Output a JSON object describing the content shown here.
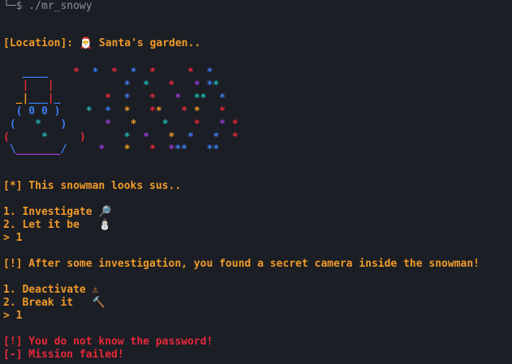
{
  "terminal": {
    "command_line": "└─$ ./mr_snowy",
    "location_line": "[Location]: 🎅 Santa's garden..",
    "status_line": "[*] This snowman looks sus..",
    "menu1": {
      "opt1": "1. Investigate 🔎",
      "opt2": "2. Let it be   ⛄",
      "input": "> 1"
    },
    "found_line": "[!] After some investigation, you found a secret camera inside the snowman!",
    "menu2": {
      "opt1": "1. Deactivate ⚠",
      "opt2": "2. Break it   🔨",
      "input": "> 1"
    },
    "error_line": "[!] You do not know the password!",
    "fail_line": "[-] Mission failed!"
  },
  "colors": {
    "background": "#1b1e24",
    "text_orange": "#f09a2a",
    "text_red": "#e8283a",
    "prompt_gray": "#8a8fa0"
  }
}
